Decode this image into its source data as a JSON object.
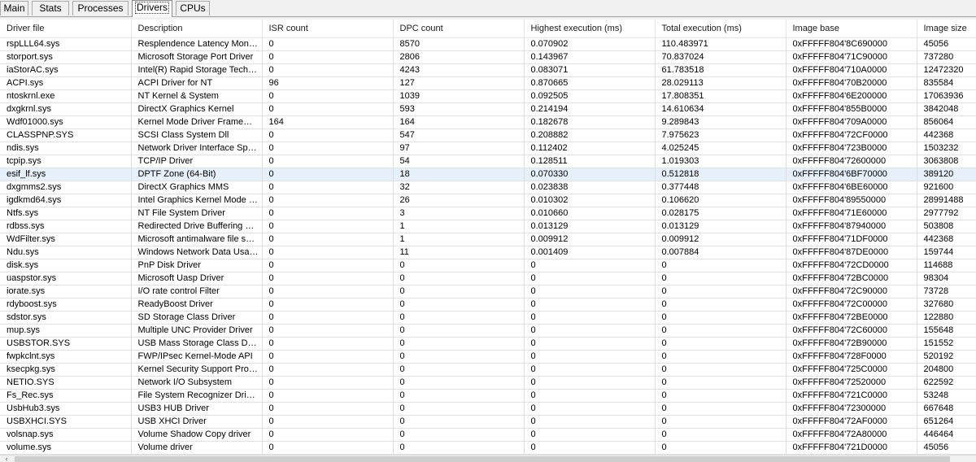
{
  "tabs": [
    {
      "label": "Main",
      "active": false
    },
    {
      "label": "Stats",
      "active": false
    },
    {
      "label": "Processes",
      "active": false
    },
    {
      "label": "Drivers",
      "active": true
    },
    {
      "label": "CPUs",
      "active": false
    }
  ],
  "table": {
    "columns": [
      "Driver file",
      "Description",
      "ISR count",
      "DPC count",
      "Highest execution (ms)",
      "Total execution (ms)",
      "Image base",
      "Image size"
    ],
    "selected_row": 10,
    "rows": [
      [
        "rspLLL64.sys",
        "Resplendence Latency Monit...",
        "0",
        "8570",
        "0.070902",
        "110.483971",
        "0xFFFFF804'8C690000",
        "45056"
      ],
      [
        "storport.sys",
        "Microsoft Storage Port Driver",
        "0",
        "2806",
        "0.143967",
        "70.837024",
        "0xFFFFF804'71C90000",
        "737280"
      ],
      [
        "iaStorAC.sys",
        "Intel(R) Rapid Storage Techno...",
        "0",
        "4243",
        "0.083071",
        "61.783518",
        "0xFFFFF804'710A0000",
        "12472320"
      ],
      [
        "ACPI.sys",
        "ACPI Driver for NT",
        "96",
        "127",
        "0.870665",
        "28.029113",
        "0xFFFFF804'70B20000",
        "835584"
      ],
      [
        "ntoskrnl.exe",
        "NT Kernel & System",
        "0",
        "1039",
        "0.092505",
        "17.808351",
        "0xFFFFF804'6E200000",
        "17063936"
      ],
      [
        "dxgkrnl.sys",
        "DirectX Graphics Kernel",
        "0",
        "593",
        "0.214194",
        "14.610634",
        "0xFFFFF804'855B0000",
        "3842048"
      ],
      [
        "Wdf01000.sys",
        "Kernel Mode Driver Framewor...",
        "164",
        "164",
        "0.182678",
        "9.289843",
        "0xFFFFF804'709A0000",
        "856064"
      ],
      [
        "CLASSPNP.SYS",
        "SCSI Class System Dll",
        "0",
        "547",
        "0.208882",
        "7.975623",
        "0xFFFFF804'72CF0000",
        "442368"
      ],
      [
        "ndis.sys",
        "Network Driver Interface Speci...",
        "0",
        "97",
        "0.112402",
        "4.025245",
        "0xFFFFF804'723B0000",
        "1503232"
      ],
      [
        "tcpip.sys",
        "TCP/IP Driver",
        "0",
        "54",
        "0.128511",
        "1.019303",
        "0xFFFFF804'72600000",
        "3063808"
      ],
      [
        "esif_lf.sys",
        "DPTF Zone (64-Bit)",
        "0",
        "18",
        "0.070330",
        "0.512818",
        "0xFFFFF804'6BF70000",
        "389120"
      ],
      [
        "dxgmms2.sys",
        "DirectX Graphics MMS",
        "0",
        "32",
        "0.023838",
        "0.377448",
        "0xFFFFF804'6BE60000",
        "921600"
      ],
      [
        "igdkmd64.sys",
        "Intel Graphics Kernel Mode Dr...",
        "0",
        "26",
        "0.010302",
        "0.106620",
        "0xFFFFF804'89550000",
        "28991488"
      ],
      [
        "Ntfs.sys",
        "NT File System Driver",
        "0",
        "3",
        "0.010660",
        "0.028175",
        "0xFFFFF804'71E60000",
        "2977792"
      ],
      [
        "rdbss.sys",
        "Redirected Drive Buffering Su...",
        "0",
        "1",
        "0.013129",
        "0.013129",
        "0xFFFFF804'87940000",
        "503808"
      ],
      [
        "WdFilter.sys",
        "Microsoft antimalware file sys...",
        "0",
        "1",
        "0.009912",
        "0.009912",
        "0xFFFFF804'71DF0000",
        "442368"
      ],
      [
        "Ndu.sys",
        "Windows Network Data Usag...",
        "0",
        "11",
        "0.001409",
        "0.007884",
        "0xFFFFF804'87DE0000",
        "159744"
      ],
      [
        "disk.sys",
        "PnP Disk Driver",
        "0",
        "0",
        "0",
        "0",
        "0xFFFFF804'72CD0000",
        "114688"
      ],
      [
        "uaspstor.sys",
        "Microsoft Uasp Driver",
        "0",
        "0",
        "0",
        "0",
        "0xFFFFF804'72BC0000",
        "98304"
      ],
      [
        "iorate.sys",
        "I/O rate control Filter",
        "0",
        "0",
        "0",
        "0",
        "0xFFFFF804'72C90000",
        "73728"
      ],
      [
        "rdyboost.sys",
        "ReadyBoost Driver",
        "0",
        "0",
        "0",
        "0",
        "0xFFFFF804'72C00000",
        "327680"
      ],
      [
        "sdstor.sys",
        "SD Storage Class Driver",
        "0",
        "0",
        "0",
        "0",
        "0xFFFFF804'72BE0000",
        "122880"
      ],
      [
        "mup.sys",
        "Multiple UNC Provider Driver",
        "0",
        "0",
        "0",
        "0",
        "0xFFFFF804'72C60000",
        "155648"
      ],
      [
        "USBSTOR.SYS",
        "USB Mass Storage Class Driver",
        "0",
        "0",
        "0",
        "0",
        "0xFFFFF804'72B90000",
        "151552"
      ],
      [
        "fwpkclnt.sys",
        "FWP/IPsec Kernel-Mode API",
        "0",
        "0",
        "0",
        "0",
        "0xFFFFF804'728F0000",
        "520192"
      ],
      [
        "ksecpkg.sys",
        "Kernel Security Support Provi...",
        "0",
        "0",
        "0",
        "0",
        "0xFFFFF804'725C0000",
        "204800"
      ],
      [
        "NETIO.SYS",
        "Network I/O Subsystem",
        "0",
        "0",
        "0",
        "0",
        "0xFFFFF804'72520000",
        "622592"
      ],
      [
        "Fs_Rec.sys",
        "File System Recognizer Driver",
        "0",
        "0",
        "0",
        "0",
        "0xFFFFF804'721C0000",
        "53248"
      ],
      [
        "UsbHub3.sys",
        "USB3 HUB Driver",
        "0",
        "0",
        "0",
        "0",
        "0xFFFFF804'72300000",
        "667648"
      ],
      [
        "USBXHCI.SYS",
        "USB XHCI Driver",
        "0",
        "0",
        "0",
        "0",
        "0xFFFFF804'72AF0000",
        "651264"
      ],
      [
        "volsnap.sys",
        "Volume Shadow Copy driver",
        "0",
        "0",
        "0",
        "0",
        "0xFFFFF804'72A80000",
        "446464"
      ],
      [
        "volume.sys",
        "Volume driver",
        "0",
        "0",
        "0",
        "0",
        "0xFFFFF804'721D0000",
        "45056"
      ]
    ]
  },
  "scrollbar": {
    "left_arrow_icon": "chevron-left-icon"
  }
}
